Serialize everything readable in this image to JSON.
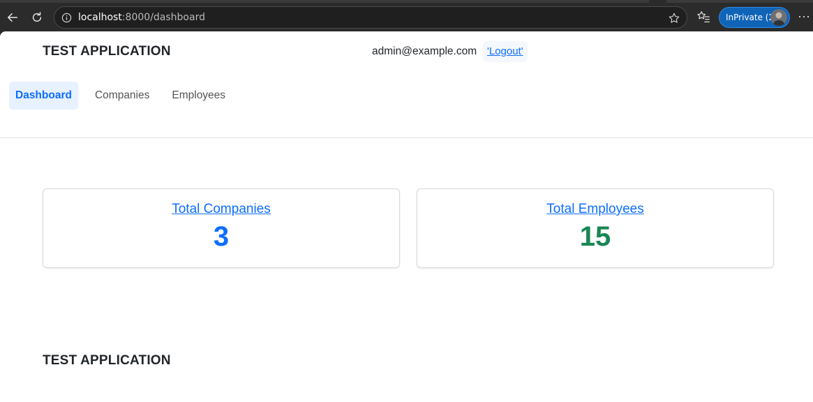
{
  "browser": {
    "url_host": "localhost",
    "url_rest": ":8000/dashboard",
    "profile_label": "InPrivate (2)",
    "more_label": "···"
  },
  "header": {
    "brand": "TEST APPLICATION",
    "user_email": "admin@example.com",
    "logout_label": "'Logout'"
  },
  "nav": {
    "items": [
      {
        "label": "Dashboard"
      },
      {
        "label": "Companies"
      },
      {
        "label": "Employees"
      }
    ]
  },
  "cards": [
    {
      "title": "Total Companies",
      "value": "3",
      "color": "#0d6efd"
    },
    {
      "title": "Total Employees",
      "value": "15",
      "color": "#198754"
    }
  ],
  "footer": {
    "brand": "TEST APPLICATION"
  }
}
